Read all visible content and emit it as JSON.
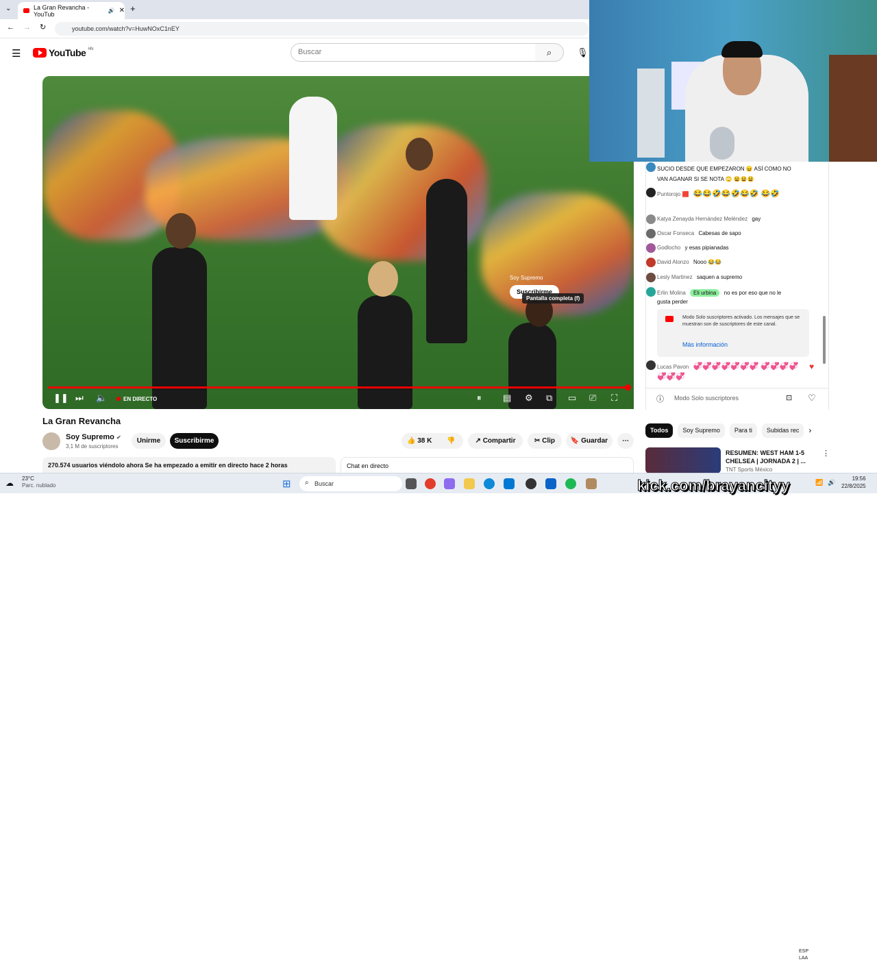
{
  "browser": {
    "tab_title": "La Gran Revancha - YouTub",
    "url": "youtube.com/watch?v=HuwNOxC1nEY"
  },
  "youtube": {
    "logo_text": "YouTube",
    "region": "HN",
    "search_placeholder": "Buscar"
  },
  "player": {
    "live_label": "EN DIRECTO",
    "overlay_channel": "Soy Supremo",
    "overlay_subscribe": "Suscribirme",
    "tooltip": "Pantalla completa (f)",
    "progress": 1.0
  },
  "video": {
    "title": "La Gran Revancha",
    "channel": "Soy Supremo",
    "subscribers": "3,1 M de suscriptores",
    "join_label": "Unirme",
    "subscribe_label": "Suscribirme",
    "likes": "38 K",
    "share_label": "Compartir",
    "clip_label": "Clip",
    "save_label": "Guardar",
    "description_stats": "270.574 usuarios viéndolo ahora  Se ha empezado a emitir en directo hace 2 horas",
    "chat_replay_label": "Chat en directo"
  },
  "chat": {
    "messages": [
      {
        "author": "",
        "text": "SUCIO DESDE QUE EMPEZARON 😖 ASÍ COMO NO VAN AGANAR SI SE NOTA 🙄 😫😫😫"
      },
      {
        "author": "Puntorojo 🟥",
        "text": "😂😂🤣😂🤣😂🤣 😂🤣"
      },
      {
        "author": "Katya Zenayda Hernández Meléndez",
        "text": "gay"
      },
      {
        "author": "Oscar Fonseca",
        "text": "Cabesas de sapo"
      },
      {
        "author": "Godlocho",
        "text": "y esas pipianadas"
      },
      {
        "author": "David Alonzo",
        "text": "Nooo 😂😂"
      },
      {
        "author": "Lesly Martinez",
        "text": "saquen a supremo"
      },
      {
        "author": "Erlin Molina",
        "badge": "Eli urbina",
        "text": "no es por eso que no le gusta perder"
      },
      {
        "author": "Lucas Pavon",
        "text": "💞💞💞💞💞💞💞 💞💞💞💞💞💞💞"
      }
    ],
    "notice_text": "Modo Solo suscriptores activado. Los mensajes que se muestran son de suscriptores de este canal.",
    "notice_link": "Más información",
    "input_placeholder": "Modo Solo suscriptores"
  },
  "chips": [
    "Todos",
    "Soy Supremo",
    "Para ti",
    "Subidas rec"
  ],
  "recommended": {
    "title": "RESUMEN: WEST HAM 1-5 CHELSEA | JORNADA 2 | ...",
    "channel": "TNT Sports México"
  },
  "taskbar": {
    "temperature": "23°C",
    "weather": "Parc. nublado",
    "search": "Buscar",
    "lang1": "ESP",
    "lang2": "LAA",
    "time": "19:56",
    "date": "22/8/2025"
  },
  "overlay_text": "kick.com/brayancityy",
  "colors": {
    "brand": "#ff0000",
    "accent": "#065fd4"
  }
}
